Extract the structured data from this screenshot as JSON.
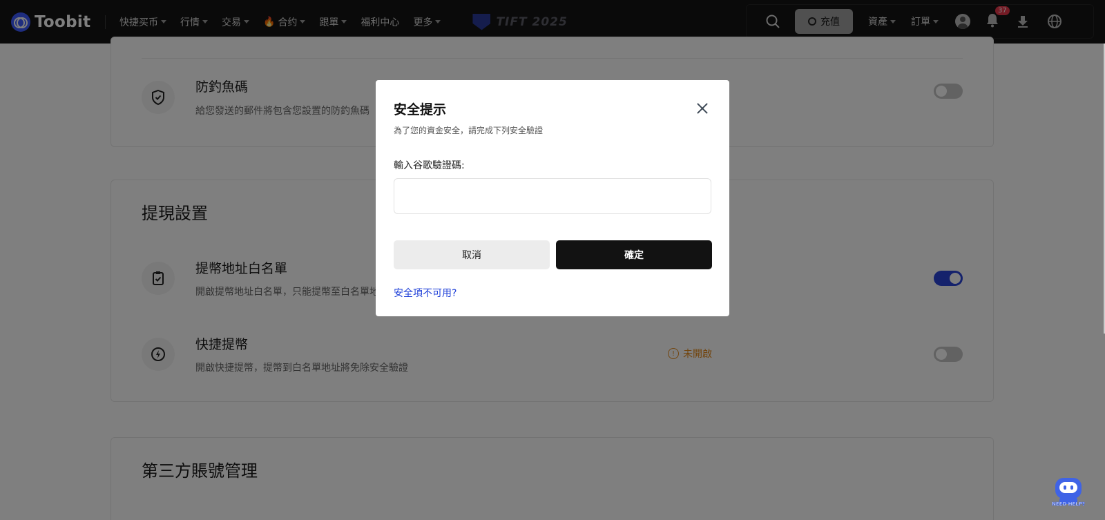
{
  "brand": {
    "name": "Toobit",
    "accent": "#3d5afe"
  },
  "nav": {
    "items": [
      {
        "label": "快捷买币",
        "has_caret": true
      },
      {
        "label": "行情",
        "has_caret": true
      },
      {
        "label": "交易",
        "has_caret": true
      },
      {
        "label": "合约",
        "has_caret": true,
        "icon": "fire-icon"
      },
      {
        "label": "跟單",
        "has_caret": true
      },
      {
        "label": "福利中心",
        "has_caret": false
      },
      {
        "label": "更多",
        "has_caret": true
      }
    ],
    "event_banner": "TIFT 2025"
  },
  "header_right": {
    "deposit_label": "充值",
    "assets_label": "資產",
    "orders_label": "訂單",
    "notification_count": "37"
  },
  "sections": {
    "anti_phishing": {
      "title": "防釣魚碼",
      "desc": "給您發送的郵件將包含您設置的防釣魚碼",
      "enabled": false
    },
    "withdraw": {
      "title": "提現設置",
      "whitelist_title": "提幣地址白名單",
      "whitelist_desc": "開啟提幣地址白名單，只能提幣至白名單地址",
      "whitelist_enabled": true,
      "quick_title": "快捷提幣",
      "quick_desc": "開啟快捷提幣，提幣到白名單地址將免除安全驗證",
      "quick_status": "未開啟",
      "quick_enabled": false
    },
    "third_party": {
      "title": "第三方賬號管理"
    }
  },
  "modal": {
    "title": "安全提示",
    "subtitle": "為了您的資金安全，請完成下列安全驗證",
    "field_label": "輸入谷歌驗證碼:",
    "field_value": "",
    "field_placeholder": "",
    "cancel_label": "取消",
    "confirm_label": "確定",
    "help_link": "安全項不可用?"
  },
  "help_bot": {
    "label": "NEED HELP?"
  },
  "colors": {
    "toggle_on": "#2a45d8",
    "warning": "#e58a1c",
    "link": "#1e3fd8"
  }
}
